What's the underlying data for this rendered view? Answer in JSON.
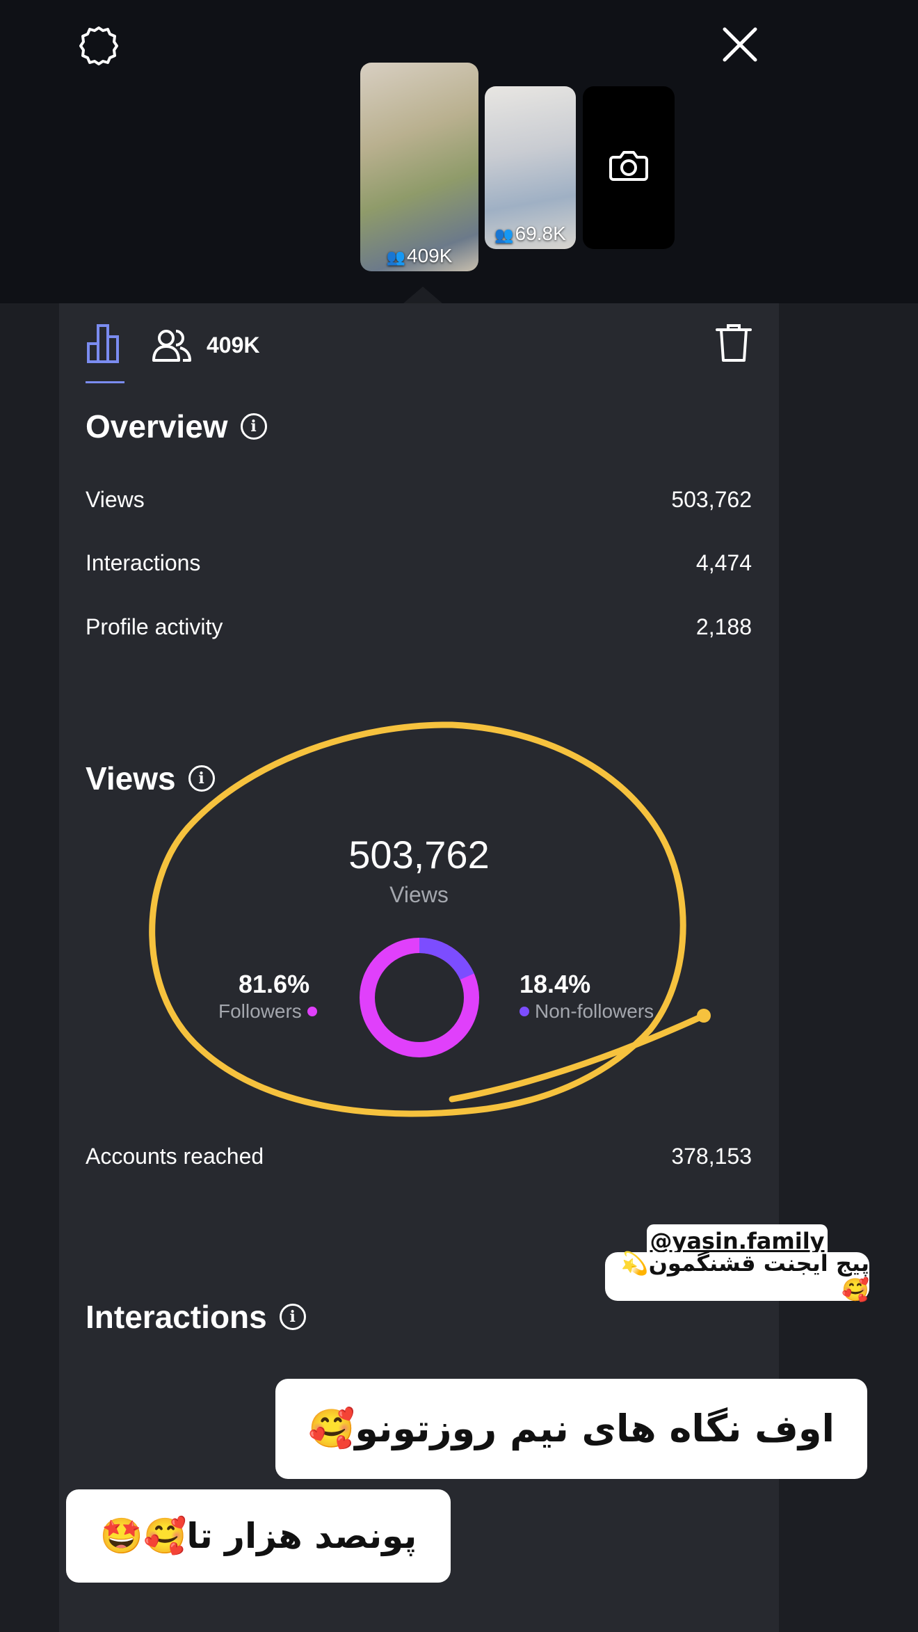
{
  "thumbnails": [
    {
      "count": "409K"
    },
    {
      "count": "69.8K"
    },
    {
      "count": ""
    }
  ],
  "tabs": {
    "count": "409K"
  },
  "overview": {
    "title": "Overview",
    "rows": [
      {
        "label": "Views",
        "value": "503,762"
      },
      {
        "label": "Interactions",
        "value": "4,474"
      },
      {
        "label": "Profile activity",
        "value": "2,188"
      }
    ]
  },
  "views": {
    "title": "Views",
    "total": "503,762",
    "total_label": "Views",
    "followers_pct": "81.6%",
    "followers_label": "Followers",
    "nonfollowers_pct": "18.4%",
    "nonfollowers_label": "Non-followers",
    "followers_fraction": 0.816,
    "colors": {
      "followers": "#e040fb",
      "nonfollowers": "#7c4dff"
    }
  },
  "accounts_reached": {
    "label": "Accounts reached",
    "value": "378,153"
  },
  "interactions": {
    "title": "Interactions"
  },
  "stickers": {
    "mention": "@yasin.family",
    "caption1": "پیج ایجنت قشنگمون💫🥰",
    "caption2": "اوف نگاه های نیم روزتونو🥰",
    "caption3": "پونصد هزار تا🥰🤩"
  },
  "colors": {
    "accent": "#7b8cf0",
    "highlight_circle": "#f6c23e",
    "panel": "#27292f",
    "background": "#1c1e23"
  }
}
